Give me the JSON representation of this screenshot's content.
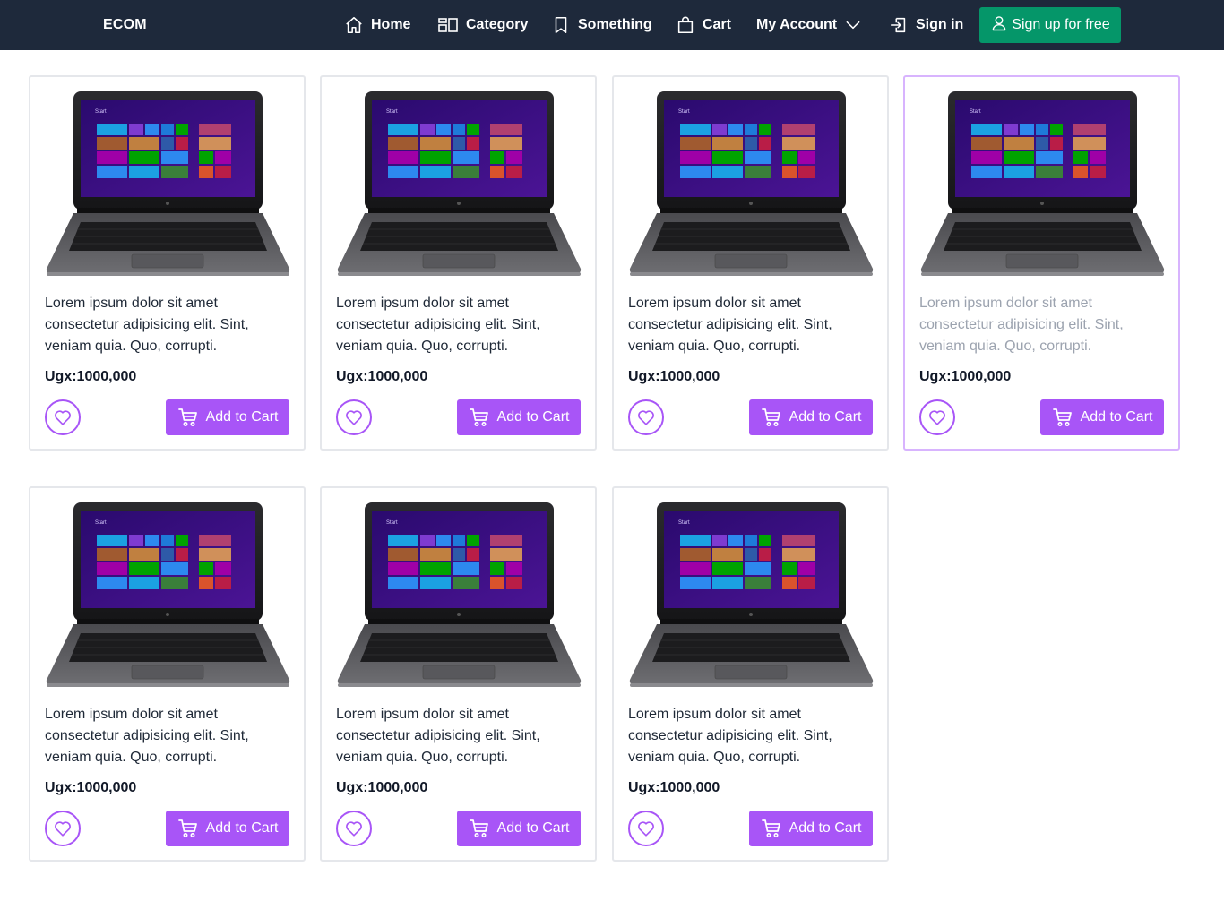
{
  "navbar": {
    "brand": "ECOM",
    "items": [
      {
        "label": "Home",
        "icon": "home-icon"
      },
      {
        "label": "Category",
        "icon": "category-icon"
      },
      {
        "label": "Something",
        "icon": "bookmark-icon"
      },
      {
        "label": "Cart",
        "icon": "shopping-bag-icon"
      },
      {
        "label": "My Account",
        "icon": "chevron-down-icon"
      },
      {
        "label": "Sign in",
        "icon": "sign-in-icon"
      }
    ],
    "signup_label": "Sign up for free"
  },
  "colors": {
    "navbar_bg": "#1e293b",
    "signup_bg": "#059669",
    "accent": "#a855f7",
    "active_card_border": "#d8b4fe"
  },
  "products": [
    {
      "description": "Lorem ipsum dolor sit amet consectetur adipisicing elit. Sint, veniam quia. Quo, corrupti.",
      "price": "Ugx:1000,000",
      "button_label": "Add to Cart",
      "image": "laptop-image"
    },
    {
      "description": "Lorem ipsum dolor sit amet consectetur adipisicing elit. Sint, veniam quia. Quo, corrupti.",
      "price": "Ugx:1000,000",
      "button_label": "Add to Cart",
      "image": "laptop-image"
    },
    {
      "description": "Lorem ipsum dolor sit amet consectetur adipisicing elit. Sint, veniam quia. Quo, corrupti.",
      "price": "Ugx:1000,000",
      "button_label": "Add to Cart",
      "image": "laptop-image"
    },
    {
      "description": "Lorem ipsum dolor sit amet consectetur adipisicing elit. Sint, veniam quia. Quo, corrupti.",
      "price": "Ugx:1000,000",
      "button_label": "Add to Cart",
      "image": "laptop-image"
    },
    {
      "description": "Lorem ipsum dolor sit amet consectetur adipisicing elit. Sint, veniam quia. Quo, corrupti.",
      "price": "Ugx:1000,000",
      "button_label": "Add to Cart",
      "image": "laptop-image"
    },
    {
      "description": "Lorem ipsum dolor sit amet consectetur adipisicing elit. Sint, veniam quia. Quo, corrupti.",
      "price": "Ugx:1000,000",
      "button_label": "Add to Cart",
      "image": "laptop-image"
    },
    {
      "description": "Lorem ipsum dolor sit amet consectetur adipisicing elit. Sint, veniam quia. Quo, corrupti.",
      "price": "Ugx:1000,000",
      "button_label": "Add to Cart",
      "image": "laptop-image"
    }
  ]
}
